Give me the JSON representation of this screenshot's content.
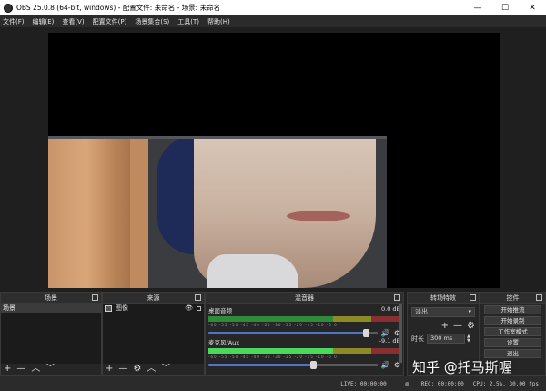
{
  "window": {
    "title": "OBS 25.0.8 (64-bit, windows) - 配置文件: 未命名 - 场景: 未命名",
    "minimize": "—",
    "maximize": "☐",
    "close": "✕"
  },
  "menu": [
    "文件(F)",
    "编辑(E)",
    "查看(V)",
    "配置文件(P)",
    "场景集合(S)",
    "工具(T)",
    "帮助(H)"
  ],
  "scenes": {
    "title": "场景",
    "items": [
      "场景"
    ]
  },
  "sources": {
    "title": "来源",
    "items": [
      {
        "name": "图像",
        "icon": "image-icon"
      }
    ]
  },
  "mixer": {
    "title": "混音器",
    "channels": [
      {
        "name": "桌面音频",
        "db": "0.0 dB",
        "level": 0.0,
        "fader": 0.93,
        "scale": "-60 -55 -50 -45 -40 -35 -30 -25 -20 -15 -10 -5 0"
      },
      {
        "name": "麦克风/Aux",
        "db": "-9.1 dB",
        "level": 0.6,
        "fader": 0.62,
        "scale": "-60 -55 -50 -45 -40 -35 -30 -25 -20 -15 -10 -5 0"
      }
    ]
  },
  "transitions": {
    "title": "转场特效",
    "selected": "淡出",
    "duration_label": "时长",
    "duration_value": "300 ms"
  },
  "controls": {
    "title": "控件",
    "buttons": [
      "开始推流",
      "开始录制",
      "工作室模式",
      "设置",
      "退出"
    ]
  },
  "status": {
    "live": "LIVE: 00:00:00",
    "rec": "REC: 00:00:00",
    "cpu": "CPU: 2.5%, 30.00 fps"
  },
  "watermark": "知乎 @托马斯喔",
  "icons": {
    "add": "+",
    "remove": "—",
    "up": "︿",
    "down": "﹀",
    "gear": "⚙",
    "speaker": "🔊",
    "eye": "👁"
  },
  "colors": {
    "background": "#1f1f1f",
    "panel": "#262626",
    "meter_green": "#4ad95a",
    "fader_blue": "#4d74c9"
  }
}
